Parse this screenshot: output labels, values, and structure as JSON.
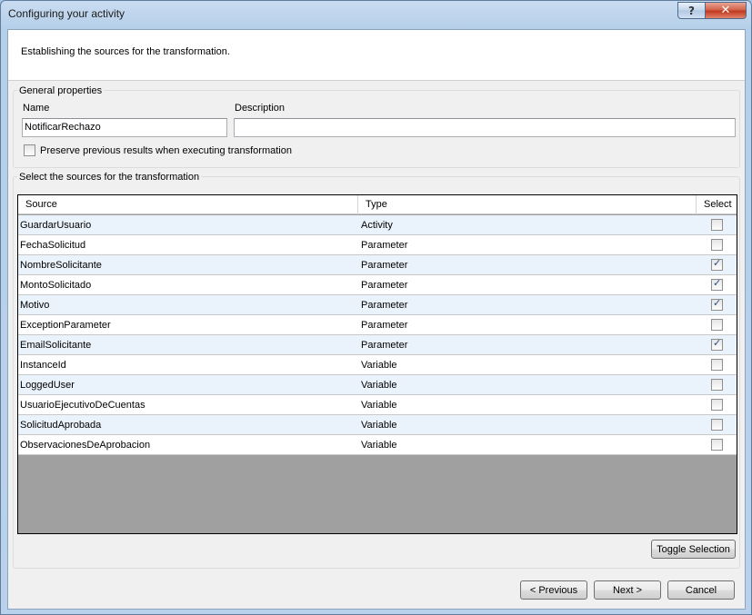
{
  "window": {
    "title": "Configuring your activity",
    "help_label": "?",
    "close_label": "✕"
  },
  "banner": {
    "text": "Establishing the sources for the transformation."
  },
  "general": {
    "group_label": "General properties",
    "name_label": "Name",
    "name_value": "NotificarRechazo",
    "description_label": "Description",
    "description_value": "",
    "preserve_label": "Preserve previous results when executing transformation",
    "preserve_checked": false
  },
  "sources": {
    "group_label": "Select the sources for the transformation",
    "columns": [
      "Source",
      "Type",
      "Select"
    ],
    "rows": [
      {
        "source": "GuardarUsuario",
        "type": "Activity",
        "selected": false
      },
      {
        "source": "FechaSolicitud",
        "type": "Parameter",
        "selected": false
      },
      {
        "source": "NombreSolicitante",
        "type": "Parameter",
        "selected": true
      },
      {
        "source": "MontoSolicitado",
        "type": "Parameter",
        "selected": true
      },
      {
        "source": "Motivo",
        "type": "Parameter",
        "selected": true
      },
      {
        "source": "ExceptionParameter",
        "type": "Parameter",
        "selected": false
      },
      {
        "source": "EmailSolicitante",
        "type": "Parameter",
        "selected": true
      },
      {
        "source": "InstanceId",
        "type": "Variable",
        "selected": false
      },
      {
        "source": "LoggedUser",
        "type": "Variable",
        "selected": false
      },
      {
        "source": "UsuarioEjecutivoDeCuentas",
        "type": "Variable",
        "selected": false
      },
      {
        "source": "SolicitudAprobada",
        "type": "Variable",
        "selected": false
      },
      {
        "source": "ObservacionesDeAprobacion",
        "type": "Variable",
        "selected": false
      }
    ]
  },
  "buttons": {
    "toggle_selection": "Toggle Selection",
    "previous": "< Previous",
    "next": "Next >",
    "cancel": "Cancel"
  }
}
